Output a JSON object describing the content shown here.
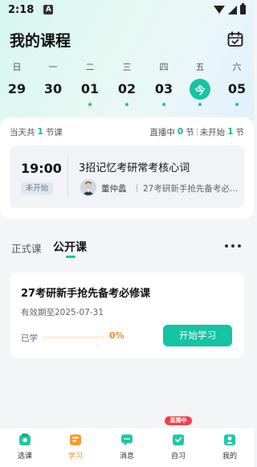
{
  "status_bar": {
    "time": "2:18",
    "notification_icon": "A"
  },
  "header": {
    "title": "我的课程",
    "calendar_icon": "calendar-icon"
  },
  "week": [
    {
      "weekday": "日",
      "date": "29",
      "has_course": false,
      "today": false
    },
    {
      "weekday": "一",
      "date": "30",
      "has_course": false,
      "today": false
    },
    {
      "weekday": "二",
      "date": "01",
      "has_course": true,
      "today": false
    },
    {
      "weekday": "三",
      "date": "02",
      "has_course": true,
      "today": false
    },
    {
      "weekday": "四",
      "date": "03",
      "has_course": true,
      "today": false
    },
    {
      "weekday": "五",
      "date": "今",
      "has_course": true,
      "today": true
    },
    {
      "weekday": "六",
      "date": "05",
      "has_course": true,
      "today": false
    }
  ],
  "today_summary": {
    "prefix": "当天共",
    "count": "1",
    "suffix": "节课",
    "live_prefix": "直播中",
    "live_count": "0",
    "live_suffix": "节",
    "pending_prefix": "未开始",
    "pending_count": "1",
    "pending_suffix": "节"
  },
  "lesson": {
    "time": "19:00",
    "status": "未开始",
    "title": "3招记忆考研常考核心词",
    "teacher": "董仲蠡",
    "course": "27考研新手抢先备考必修课"
  },
  "tabs": {
    "formal": "正式课",
    "open": "公开课"
  },
  "course_card": {
    "title": "27考研新手抢先备考必修课",
    "valid_until": "有效期至2025-07-31",
    "learned_label": "已学",
    "progress_percent": 0,
    "progress_text": "0%",
    "start_button": "开始学习"
  },
  "colors": {
    "accent": "#14c4a2",
    "orange": "#f28a2a",
    "live_red": "#f23f4a"
  },
  "bottom_nav": {
    "items": [
      {
        "label": "选课",
        "icon": "select-course-icon",
        "active": false
      },
      {
        "label": "学习",
        "icon": "study-icon",
        "active": true
      },
      {
        "label": "消息",
        "icon": "message-icon",
        "active": false
      },
      {
        "label": "自习",
        "icon": "self-study-icon",
        "active": false
      },
      {
        "label": "我的",
        "icon": "profile-icon",
        "active": false
      }
    ],
    "live_badge": "直播中"
  }
}
